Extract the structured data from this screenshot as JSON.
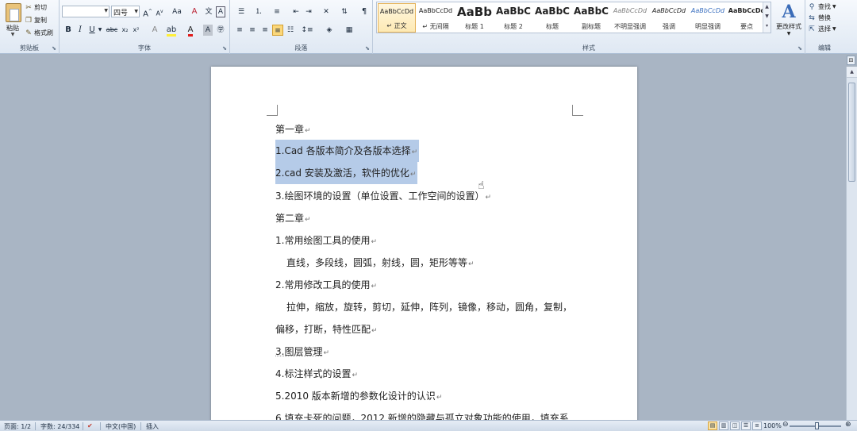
{
  "ribbon": {
    "clipboard": {
      "paste": "粘贴",
      "cut": "剪切",
      "copy": "复制",
      "format_painter": "格式刷",
      "group_label": "剪贴板"
    },
    "font": {
      "font_name": "",
      "font_size": "四号",
      "group_label": "字体",
      "bold": "B",
      "italic": "I",
      "underline": "U",
      "strikethrough": "abc",
      "subscript": "x₂",
      "superscript": "x²",
      "grow": "A",
      "shrink": "A",
      "change_case": "Aa",
      "clear_format": "A",
      "font_color": "A",
      "char_border": "A",
      "char_shade": "A",
      "enclose": "字"
    },
    "paragraph": {
      "group_label": "段落"
    },
    "styles": {
      "group_label": "样式",
      "items": [
        {
          "sample": "AaBbCcDd",
          "name": "正文",
          "prefix": "↵"
        },
        {
          "sample": "AaBbCcDd",
          "name": "无间隔",
          "prefix": "↵"
        },
        {
          "sample": "AaBb",
          "name": "标题 1"
        },
        {
          "sample": "AaBbC",
          "name": "标题 2"
        },
        {
          "sample": "AaBbC",
          "name": "标题"
        },
        {
          "sample": "AaBbC",
          "name": "副标题"
        },
        {
          "sample": "AaBbCcDd",
          "name": "不明显强调"
        },
        {
          "sample": "AaBbCcDd",
          "name": "强调"
        },
        {
          "sample": "AaBbCcDd",
          "name": "明显强调"
        },
        {
          "sample": "AaBbCcDd",
          "name": "要点"
        }
      ],
      "change_styles": "更改样式"
    },
    "editing": {
      "group_label": "编辑",
      "find": "查找",
      "replace": "替换",
      "select": "选择"
    }
  },
  "document": {
    "paragraphs": [
      {
        "text": "第一章",
        "mark": "↵"
      },
      {
        "text": "1.Cad 各版本简介及各版本选择",
        "mark": "↵",
        "selected": true
      },
      {
        "text": "2.cad 安装及激活，软件的优化",
        "mark": "↵",
        "selected": true
      },
      {
        "text": "3.绘图环境的设置（单位设置、工作空间的设置）",
        "mark": "↵"
      },
      {
        "text": "第二章",
        "mark": "↵"
      },
      {
        "text": "1.常用绘图工具的使用",
        "mark": "↵"
      },
      {
        "text": "直线，多段线，圆弧，射线，圆，矩形等等",
        "mark": "↵"
      },
      {
        "text": "2.常用修改工具的使用",
        "mark": "↵"
      },
      {
        "text": "拉伸，缩放，旋转，剪切，延伸，阵列，镜像，移动，圆角，复制，",
        "mark": ""
      },
      {
        "text": "偏移，打断，特性匹配",
        "mark": "↵"
      },
      {
        "text": "3.图层管理",
        "mark": "↵"
      },
      {
        "text": "4.标注样式的设置",
        "mark": "↵"
      },
      {
        "text": "5.2010 版本新增的参数化设计的认识",
        "mark": "↵"
      },
      {
        "text": "6.填充卡死的问题，2012 新增的隐藏与孤立对象功能的使用，填充系",
        "mark": ""
      }
    ]
  },
  "statusbar": {
    "page": "页面: 1/2",
    "words": "字数: 24/334",
    "language": "中文(中国)",
    "mode": "插入",
    "zoom": "100%"
  },
  "colors": {
    "selection": "#b5cbe8",
    "ribbon_bg": "#dfe8f3",
    "workspace": "#a9b5c4"
  }
}
